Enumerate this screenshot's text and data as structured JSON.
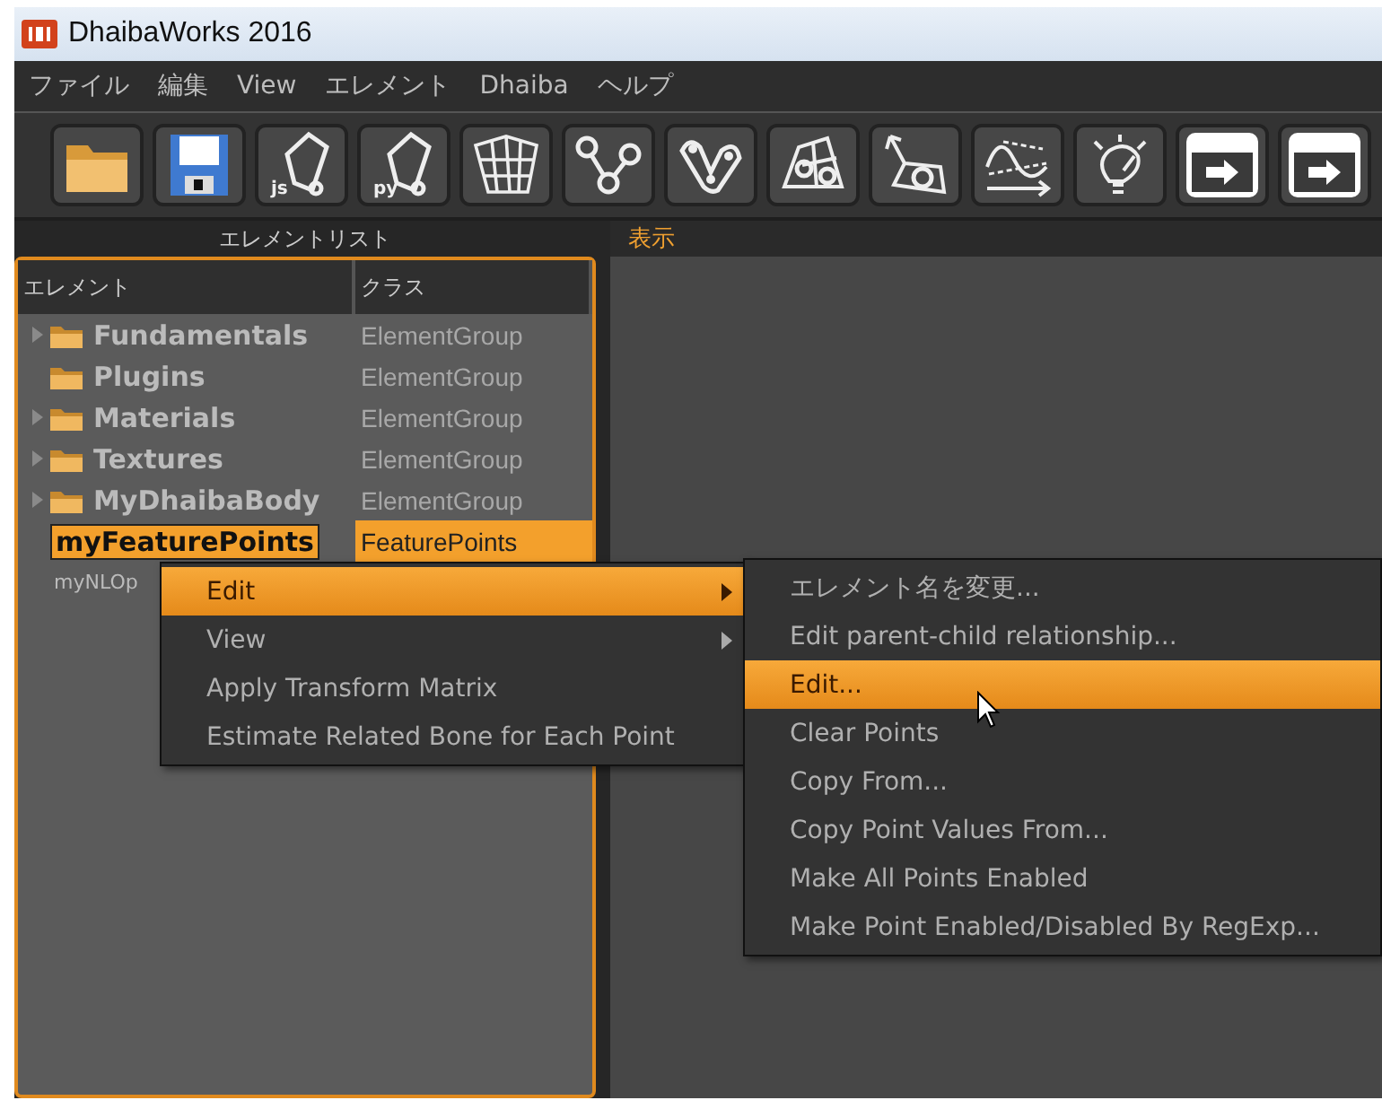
{
  "window": {
    "title": "DhaibaWorks 2016"
  },
  "menu_bar": [
    "ファイル",
    "編集",
    "View",
    "エレメント",
    "Dhaiba",
    "ヘルプ"
  ],
  "toolbar": [
    {
      "kind": "folder"
    },
    {
      "kind": "save"
    },
    {
      "kind": "script",
      "badge": "js"
    },
    {
      "kind": "script",
      "badge": "py"
    },
    {
      "kind": "cube"
    },
    {
      "kind": "nodes"
    },
    {
      "kind": "path"
    },
    {
      "kind": "surface"
    },
    {
      "kind": "bone"
    },
    {
      "kind": "curve"
    },
    {
      "kind": "bulb"
    },
    {
      "kind": "export"
    },
    {
      "kind": "export"
    }
  ],
  "element_panel": {
    "title": "エレメントリスト",
    "columns": [
      "エレメント",
      "クラス"
    ],
    "rows": [
      {
        "kind": "folder",
        "name": "Fundamentals",
        "class": "ElementGroup",
        "has_children": true,
        "selected": false
      },
      {
        "kind": "folder",
        "name": "Plugins",
        "class": "ElementGroup",
        "has_children": false,
        "selected": false
      },
      {
        "kind": "folder",
        "name": "Materials",
        "class": "ElementGroup",
        "has_children": true,
        "selected": false
      },
      {
        "kind": "folder",
        "name": "Textures",
        "class": "ElementGroup",
        "has_children": true,
        "selected": false
      },
      {
        "kind": "folder",
        "name": "MyDhaibaBody",
        "class": "ElementGroup",
        "has_children": true,
        "selected": false
      },
      {
        "kind": "item",
        "name": "myFeaturePoints",
        "class": "FeaturePoints",
        "has_children": false,
        "selected": true
      },
      {
        "kind": "item",
        "name": "myNLOp",
        "class": "",
        "has_children": false,
        "selected": false
      }
    ]
  },
  "view_panel": {
    "title": "表示"
  },
  "context_menu": [
    {
      "label": "Edit",
      "has_submenu": true,
      "selected": true
    },
    {
      "label": "View",
      "has_submenu": true,
      "selected": false
    },
    {
      "label": "Apply Transform Matrix",
      "has_submenu": false,
      "selected": false
    },
    {
      "label": "Estimate Related Bone for Each Point",
      "has_submenu": false,
      "selected": false
    }
  ],
  "submenu": [
    {
      "label": "エレメント名を変更...",
      "selected": false
    },
    {
      "label": "Edit parent-child relationship...",
      "selected": false
    },
    {
      "label": "Edit...",
      "selected": true
    },
    {
      "label": "Clear Points",
      "selected": false
    },
    {
      "label": "Copy From...",
      "selected": false
    },
    {
      "label": "Copy Point Values From...",
      "selected": false
    },
    {
      "label": "Make All Points Enabled",
      "selected": false
    },
    {
      "label": "Make Point Enabled/Disabled By RegExp...",
      "selected": false
    }
  ]
}
